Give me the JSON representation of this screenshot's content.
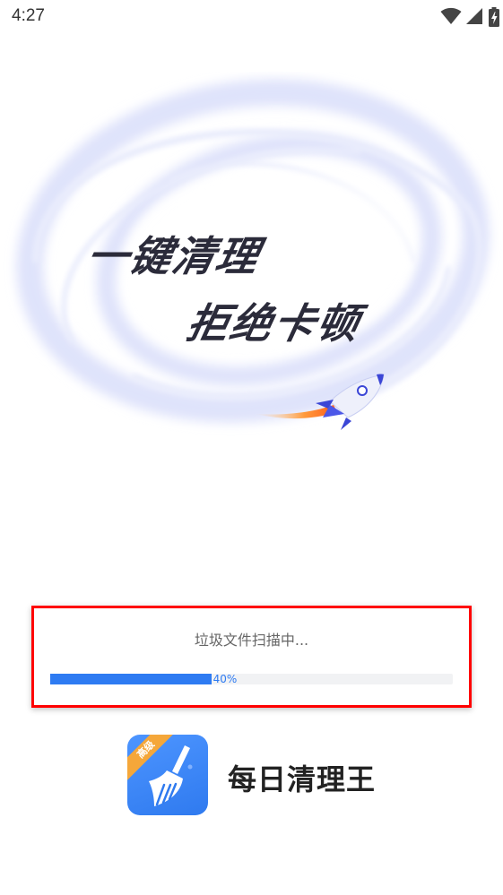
{
  "status_bar": {
    "time": "4:27",
    "icons": [
      "wifi-icon",
      "signal-icon",
      "battery-charging-icon"
    ]
  },
  "hero": {
    "line1": "一键清理",
    "line2": "拒绝卡顿",
    "illustration": "rocket-icon",
    "colors": {
      "swirl": "#d8defc",
      "rocket": "#3b46d6",
      "flame": "#ff7a1a"
    }
  },
  "scan": {
    "status_text": "垃圾文件扫描中...",
    "progress_value": 40,
    "progress_label": "40%",
    "colors": {
      "border": "#ff0000",
      "fill": "#2e7bf2",
      "track": "#f1f2f4"
    }
  },
  "app": {
    "icon_badge": "高级",
    "icon_symbol": "broom-icon",
    "name": "每日清理王"
  }
}
